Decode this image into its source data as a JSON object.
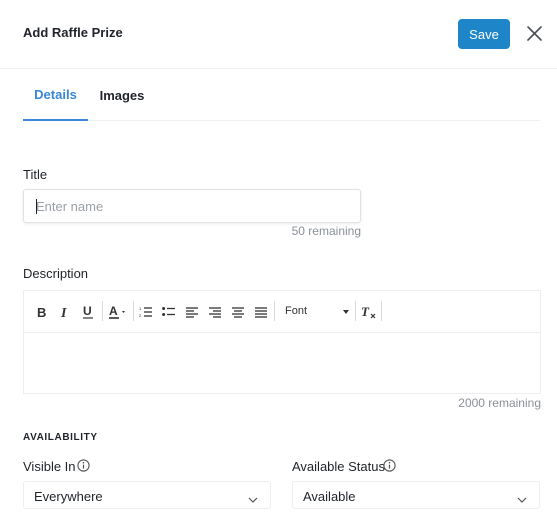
{
  "header": {
    "title": "Add Raffle Prize",
    "save_label": "Save",
    "close_icon": "close-icon"
  },
  "tabs": [
    {
      "label": "Details",
      "active": true
    },
    {
      "label": "Images",
      "active": false
    }
  ],
  "title_field": {
    "label": "Title",
    "placeholder": "Enter name",
    "value": "",
    "remaining": "50 remaining"
  },
  "description_field": {
    "label": "Description",
    "toolbar": {
      "items": [
        "bold-icon",
        "italic-icon",
        "underline-icon",
        "font-color-icon",
        "ordered-list-icon",
        "bullet-list-icon",
        "align-left-icon",
        "align-right-icon",
        "align-center-icon",
        "align-justify-icon",
        "clear-format-icon"
      ],
      "font_label": "Font"
    },
    "value": "",
    "remaining": "2000 remaining"
  },
  "availability": {
    "heading": "AVAILABILITY",
    "visible_in": {
      "label": "Visible In",
      "value": "Everywhere"
    },
    "available_status": {
      "label": "Available Status",
      "value": "Available"
    }
  },
  "colors": {
    "accent": "#3a86d6",
    "save_button": "#1e86c8"
  }
}
